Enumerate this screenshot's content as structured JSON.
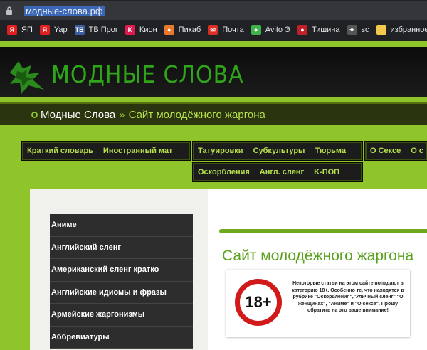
{
  "browser": {
    "url": "модные-слова.рф",
    "bookmarks": [
      {
        "label": "ЯП",
        "icon": "yandex-icon",
        "color": "#e02020",
        "glyph": "Я"
      },
      {
        "label": "Yap",
        "icon": "yandex-icon",
        "color": "#e02020",
        "glyph": "Я"
      },
      {
        "label": "ТВ Прог",
        "icon": "tv-icon",
        "color": "#3a5f9e",
        "glyph": "ТВ"
      },
      {
        "label": "Кион",
        "icon": "kion-icon",
        "color": "#e0194f",
        "glyph": "K"
      },
      {
        "label": "Пикаб",
        "icon": "pikabu-icon",
        "color": "#e8792a",
        "glyph": "●"
      },
      {
        "label": "Почта",
        "icon": "gmail-icon",
        "color": "#d93025",
        "glyph": "✉"
      },
      {
        "label": "Avito Э",
        "icon": "avito-icon",
        "color": "#3fb24c",
        "glyph": "●"
      },
      {
        "label": "Тишина",
        "icon": "tishina-icon",
        "color": "#c0202a",
        "glyph": "●"
      },
      {
        "label": "sc",
        "icon": "sc-icon",
        "color": "#555555",
        "glyph": "✦"
      },
      {
        "label": "избранное",
        "icon": "folder-icon",
        "color": "#f2c94c",
        "glyph": ""
      }
    ]
  },
  "site": {
    "logo_text": "Модные слова",
    "breadcrumb": {
      "home": "Модные Слова",
      "separator": "»",
      "current": "Сайт молодёжного жаргона"
    },
    "nav": [
      {
        "items": [
          "Краткий словарь",
          "Иностранный мат"
        ]
      },
      {
        "items": [
          "Татуировки",
          "Субкультуры",
          "Тюрьма"
        ]
      },
      {
        "items": [
          "О Сексе",
          "О с"
        ]
      },
      {
        "items": [
          "Оскорбления",
          "Англ. сленг",
          "K-ПОП"
        ]
      }
    ],
    "sidebar": [
      "Аниме",
      "Английский сленг",
      "Американский сленг кратко",
      "Английские идиомы и фразы",
      "Армейские жаргонизмы",
      "Аббревиатуры"
    ],
    "title": "Сайт молодёжного жаргона",
    "warning": {
      "badge": "18+",
      "text": "Некоторые статьи на этом сайте попадают в категорию 18+. Особенно те, что находятся в рубрике \"Оскорбления\",\"Уличный сленг\" \"О женщинах\", \"Аниме\" и \"О сексе\". Прошу обратить на это ваше внимание!"
    }
  }
}
